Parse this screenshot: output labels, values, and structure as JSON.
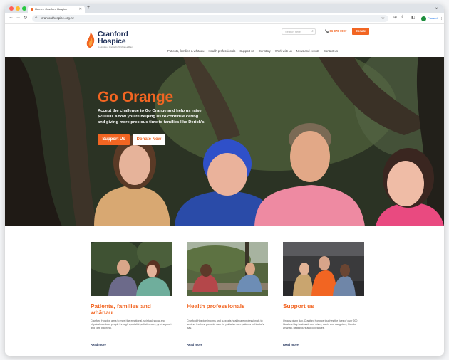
{
  "browser": {
    "tab_title": "Home - Cranford Hospice",
    "url": "cranfordhospice.org.nz",
    "profile_label": "Paused",
    "traffic_lights": [
      "#ff5f57",
      "#febc2e",
      "#28c840"
    ]
  },
  "site": {
    "logo_line1": "Cranford",
    "logo_line2": "Hospice",
    "logo_tagline": "Te Hospice o Cranford ki Te Matau-a-Māui",
    "search_placeholder": "Search here",
    "phone": "06 878 7007",
    "donate_label": "Donate",
    "accent": "#f26522",
    "navy": "#1e2f58",
    "nav": [
      "Patients, families & whānau",
      "Health professionals",
      "Support us",
      "Our story",
      "Work with us",
      "News and events",
      "Contact us"
    ]
  },
  "hero": {
    "title": "Go Orange",
    "text": "Accept the challenge to Go Orange and help us raise $70,000. Know you're helping us to continue caring and giving more precious time to families like Derick's.",
    "support_label": "Support Us",
    "donate_label": "Donate Now"
  },
  "cards": [
    {
      "title": "Patients, families and whānau",
      "desc": "Cranford Hospice aims to meet the emotional, spiritual, social and physical needs of people through specialist palliative care, grief support and care planning.",
      "link": "Read more"
    },
    {
      "title": "Health professionals",
      "desc": "Cranford Hospice informs and supports healthcare professionals to achieve the best possible care for palliative care patients in Hawke's Bay.",
      "link": "Read more"
    },
    {
      "title": "Support us",
      "desc": "On any given day, Cranford Hospice touches the lives of over 200 Hawke's Bay husbands and wives, aunts and daughters, friends, whānau, neighbours and colleagues.",
      "link": "Read more"
    }
  ]
}
